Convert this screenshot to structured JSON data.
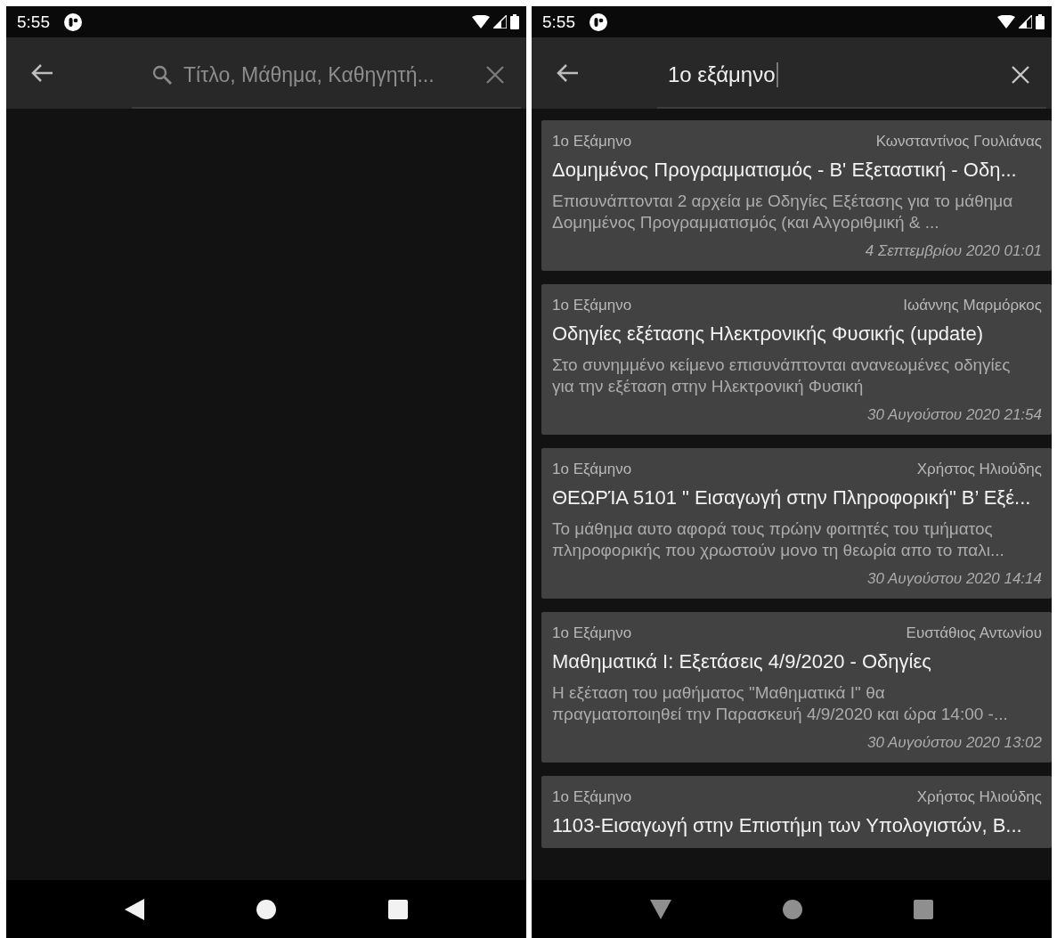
{
  "screens": [
    {
      "status_bar": {
        "time": "5:55"
      },
      "search": {
        "placeholder": "Τίτλο, Μάθημα, Καθηγητή...",
        "focused": false
      },
      "nav_bar": {
        "back_button": {
          "kind": "back"
        },
        "dimmed": false
      }
    },
    {
      "status_bar": {
        "time": "5:55"
      },
      "search": {
        "value": "1ο εξάμηνο",
        "focused": true
      },
      "results": [
        {
          "semester": "1ο Εξάμηνο",
          "author": "Κωνσταντίνος Γουλιάνας",
          "title": "Δομημένος Προγραμματισμός - Β' Εξεταστική - Οδη...",
          "summary": "Επισυνάπτονται 2 αρχεία με Οδηγίες Εξέτασης για το μάθημα Δομημένος Προγραμματισμός (και Αλγοριθμική & ...",
          "date": "4 Σεπτεμβρίου 2020 01:01"
        },
        {
          "semester": "1ο Εξάμηνο",
          "author": "Ιωάννης Μαρμόρκος",
          "title": "Οδηγίες εξέτασης Ηλεκτρονικής Φυσικής (update)",
          "summary": "Στο συνημμένο κείμενο επισυνάπτονται ανανεωμένες οδηγίες για την εξέταση στην Ηλεκτρονική Φυσική",
          "date": "30 Αυγούστου 2020 21:54"
        },
        {
          "semester": "1ο Εξάμηνο",
          "author": "Χρήστος Ηλιούδης",
          "title": "ΘΕΩΡΊΑ 5101 \" Εισαγωγή στην Πληροφορική\" Β’ Εξέ...",
          "summary": "Το μάθημα αυτο αφορά τους πρώην φοιτητές του τμήματος πληροφορικής που χρωστούν μονο τη θεωρία απο το παλι...",
          "date": "30 Αυγούστου 2020 14:14"
        },
        {
          "semester": "1ο Εξάμηνο",
          "author": "Ευστάθιος Αντωνίου",
          "title": "Μαθηματικά Ι: Εξετάσεις 4/9/2020 - Οδηγίες",
          "summary": "Η εξέταση του μαθήματος \"Μαθηματικά Ι\" θα πραγματοποιηθεί την Παρασκευή 4/9/2020 και ώρα 14:00 -...",
          "date": "30 Αυγούστου 2020 13:02"
        },
        {
          "semester": "1ο Εξάμηνο",
          "author": "Χρήστος Ηλιούδης",
          "title": "1103-Εισαγωγή στην Επιστήμη των Υπολογιστών, Β..."
        }
      ],
      "nav_bar": {
        "back_button": {
          "kind": "hide-keyboard"
        },
        "dimmed": true
      }
    }
  ]
}
